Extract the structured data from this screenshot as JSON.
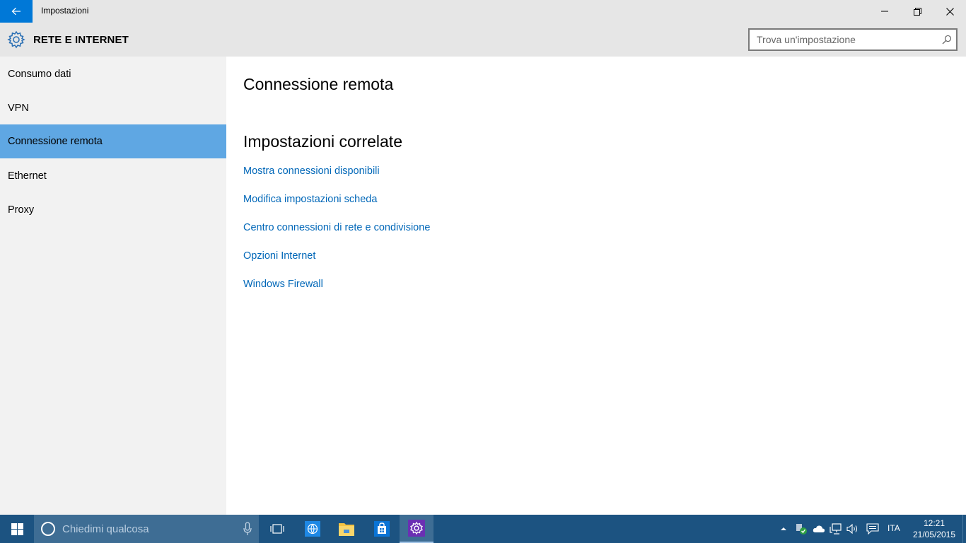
{
  "window": {
    "title": "Impostazioni",
    "back_icon": "back-arrow-icon",
    "controls": [
      "minimize-icon",
      "restore-icon",
      "close-icon"
    ]
  },
  "header": {
    "icon": "gear-icon",
    "title": "RETE E INTERNET",
    "search": {
      "placeholder": "Trova un'impostazione",
      "value": "",
      "icon": "search-icon"
    }
  },
  "sidebar": {
    "items": [
      {
        "label": "Consumo dati",
        "selected": false
      },
      {
        "label": "VPN",
        "selected": false
      },
      {
        "label": "Connessione remota",
        "selected": true
      },
      {
        "label": "Ethernet",
        "selected": false
      },
      {
        "label": "Proxy",
        "selected": false
      }
    ]
  },
  "main": {
    "heading": "Connessione remota",
    "related_heading": "Impostazioni correlate",
    "links": [
      "Mostra connessioni disponibili",
      "Modifica impostazioni scheda",
      "Centro connessioni di rete e condivisione",
      "Opzioni Internet",
      "Windows Firewall"
    ]
  },
  "taskbar": {
    "search_placeholder": "Chiedimi qualcosa",
    "apps": [
      "task-view-icon",
      "edge-browser-icon",
      "file-explorer-icon",
      "store-icon",
      "settings-icon"
    ],
    "active_app": "settings-icon",
    "tray": [
      "chevron-up-icon",
      "security-icon",
      "onedrive-icon",
      "network-icon",
      "volume-icon",
      "action-center-icon"
    ],
    "language": "ITA",
    "time": "12:21",
    "date": "21/05/2015"
  },
  "colors": {
    "accent": "#0078d7",
    "selection": "#5fa7e3",
    "link": "#0067b8",
    "taskbar": "#1c5381",
    "chrome": "#e6e6e6",
    "sidebar": "#f2f2f2"
  }
}
